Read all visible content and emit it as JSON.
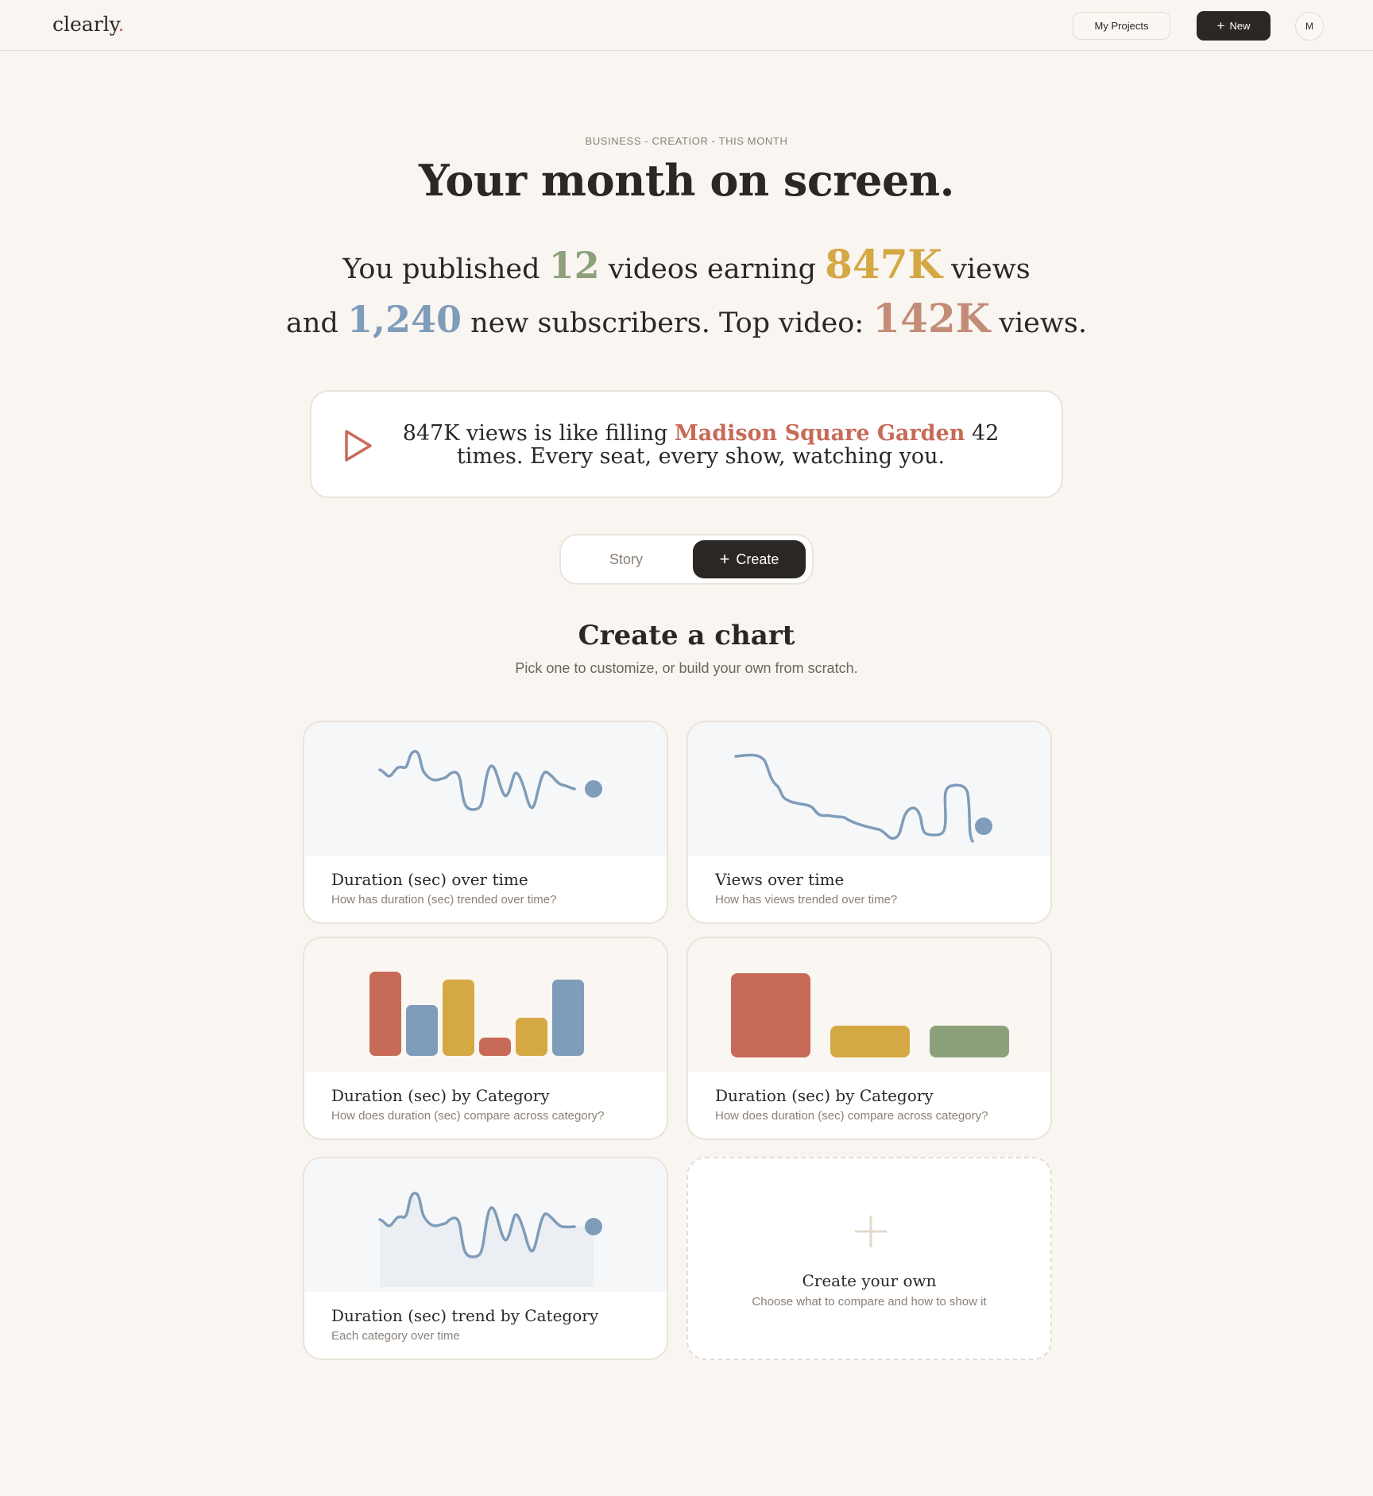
{
  "header": {
    "logo_text": "clearly",
    "logo_dot": ".",
    "my_projects_label": "My Projects",
    "new_label": "New",
    "avatar_initial": "M"
  },
  "hero": {
    "eyebrow": "BUSINESS - CREATIOR - THIS MONTH",
    "title": "Your month on screen.",
    "summary": {
      "p1": "You published ",
      "videos": "12",
      "p2": " videos earning ",
      "views": "847K",
      "p3": " views",
      "p4": "and ",
      "subscribers": "1,240",
      "p5": " new subscribers. Top video: ",
      "top_views": "142K",
      "p6": " views."
    }
  },
  "comparison": {
    "t1": "847K views is like filling ",
    "highlight": "Madison Square Garden",
    "t2": " 42 times. Every seat, every show, watching you."
  },
  "mode_toggle": {
    "story_label": "Story",
    "create_label": "Create",
    "active": "Create"
  },
  "create_section": {
    "title": "Create a chart",
    "subtitle": "Pick one to customize, or build your own from scratch."
  },
  "chart_options": [
    {
      "title": "Duration (sec) over time",
      "subtitle": "How has duration (sec) trended over time?",
      "preview": "line"
    },
    {
      "title": "Views over time",
      "subtitle": "How has views trended over time?",
      "preview": "line"
    },
    {
      "title": "Duration (sec) by Category",
      "subtitle": "How does duration (sec) compare across category?",
      "preview": "bar"
    },
    {
      "title": "Duration (sec) by Category",
      "subtitle": "How does duration (sec) compare across category?",
      "preview": "bar"
    },
    {
      "title": "Duration (sec) trend by Category",
      "subtitle": "Each category over time",
      "preview": "area"
    }
  ],
  "create_own": {
    "title": "Create your own",
    "subtitle": "Choose what to compare and how to show it"
  },
  "colors": {
    "background": "#f9f5f0",
    "ink": "#2b2724",
    "green": "#8da07c",
    "gold": "#d4a843",
    "blue": "#7f9cba",
    "terracotta": "#c76b58",
    "rose": "#c38c79",
    "line": "#7f9cba"
  }
}
